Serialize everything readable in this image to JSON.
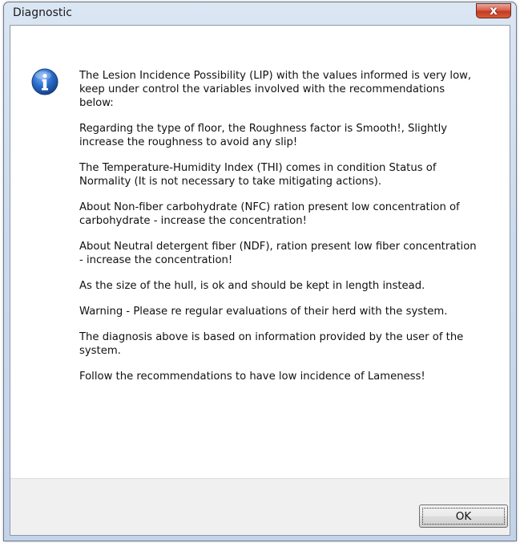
{
  "window": {
    "title": "Diagnostic",
    "close_glyph": "x"
  },
  "icon": "info-icon",
  "messages": [
    "The Lesion Incidence Possibility  (LIP) with the values informed is very low, keep under control the variables involved with the recommendations below:",
    "Regarding the type of floor, the Roughness factor is Smooth!, Slightly increase the roughness to avoid any slip!",
    "The Temperature-Humidity Index (THI) comes in condition Status of Normality (It is not necessary to take mitigating actions).",
    "About Non-fiber carbohydrate (NFC) ration present low concentration of carbohydrate - increase the concentration!",
    "About Neutral detergent fiber (NDF), ration present low fiber concentration - increase the concentration!",
    "As the size of the hull, is ok and should be kept in length instead.",
    "Warning - Please re regular evaluations of their herd with the system.",
    "The diagnosis above is based on information provided by the user of the system.",
    "Follow the recommendations to have low incidence of Lameness!"
  ],
  "buttons": {
    "ok_label": "OK"
  },
  "colors": {
    "close_button": "#c43a23",
    "info_icon": "#1f5fb5"
  }
}
